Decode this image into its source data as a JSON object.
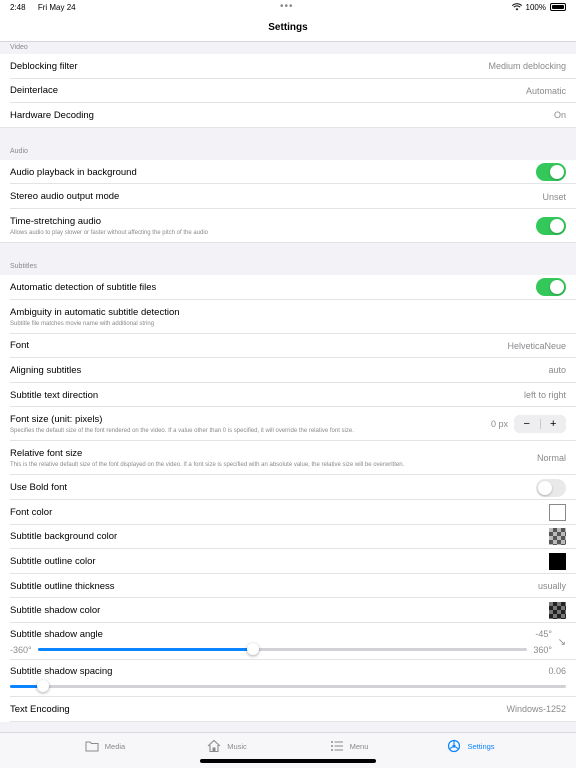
{
  "status_bar": {
    "time": "2:48",
    "date": "Fri May 24",
    "battery": "100%"
  },
  "nav": {
    "title": "Settings"
  },
  "sections": {
    "video": {
      "header": "Video",
      "rows": [
        {
          "label": "Deblocking filter",
          "value": "Medium deblocking"
        },
        {
          "label": "Deinterlace",
          "value": "Automatic"
        },
        {
          "label": "Hardware Decoding",
          "value": "On"
        }
      ]
    },
    "audio": {
      "header": "Audio",
      "playback_bg": {
        "label": "Audio playback in background",
        "toggle": "on"
      },
      "stereo": {
        "label": "Stereo audio output mode",
        "value": "Unset"
      },
      "time_stretch": {
        "label": "Time-stretching audio",
        "sub": "Allows audio to play slower or faster without affecting the pitch of the audio",
        "toggle": "on"
      }
    },
    "subtitles": {
      "header": "Subtitles",
      "auto_detect": {
        "label": "Automatic detection of subtitle files",
        "toggle": "on"
      },
      "ambiguity": {
        "label": "Ambiguity in automatic subtitle detection",
        "sub": "Subtitle file matches movie name with additional string"
      },
      "font": {
        "label": "Font",
        "value": "HelveticaNeue"
      },
      "aligning": {
        "label": "Aligning subtitles",
        "value": "auto"
      },
      "direction": {
        "label": "Subtitle text direction",
        "value": "left to right"
      },
      "font_size": {
        "label": "Font size (unit: pixels)",
        "sub": "Specifies the default size of the font rendered on the video. If a value other than 0 is specified, it will override the relative font size.",
        "value": "0 px",
        "minus": "−",
        "plus": "+"
      },
      "relative_size": {
        "label": "Relative font size",
        "sub": "This is the relative default size of the font displayed on the video. If a font size is specified with an absolute value, the relative size will be overwritten.",
        "value": "Normal"
      },
      "bold": {
        "label": "Use Bold font",
        "toggle": "off"
      },
      "font_color": {
        "label": "Font color"
      },
      "bg_color": {
        "label": "Subtitle background color"
      },
      "outline_color": {
        "label": "Subtitle outline color"
      },
      "outline_thickness": {
        "label": "Subtitle outline thickness",
        "value": "usually"
      },
      "shadow_color": {
        "label": "Subtitle shadow color"
      },
      "shadow_angle": {
        "label": "Subtitle shadow angle",
        "value": "-45°",
        "min": "-360°",
        "max": "360°",
        "fraction": 0.44
      },
      "shadow_spacing": {
        "label": "Subtitle shadow spacing",
        "value": "0.06",
        "fraction": 0.06
      },
      "encoding": {
        "label": "Text Encoding",
        "value": "Windows-1252"
      }
    }
  },
  "tabs": [
    {
      "label": "Media",
      "icon": "folder-icon"
    },
    {
      "label": "Music",
      "icon": "house-icon"
    },
    {
      "label": "Menu",
      "icon": "list-icon"
    },
    {
      "label": "Settings",
      "icon": "settings-icon",
      "active": true
    }
  ],
  "colors": {
    "accent": "#0a84ff",
    "toggle_on": "#34c759"
  }
}
